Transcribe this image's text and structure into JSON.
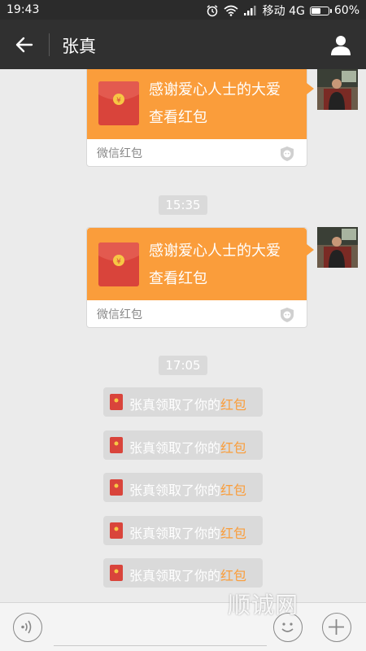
{
  "status_bar": {
    "time": "19:43",
    "carrier": "移动 4G",
    "battery_text": "60%",
    "battery_level": 0.6,
    "icons": [
      "alarm-icon",
      "wifi-icon",
      "signal-icon",
      "battery-icon"
    ]
  },
  "header": {
    "title": "张真",
    "back_icon": "back-arrow-icon",
    "profile_icon": "person-icon"
  },
  "messages": [
    {
      "type": "red_packet",
      "title": "感谢爱心人士的大爱",
      "subtitle": "查看红包",
      "footer": "微信红包"
    },
    {
      "type": "timestamp",
      "text": "15:35"
    },
    {
      "type": "red_packet",
      "title": "感谢爱心人士的大爱",
      "subtitle": "查看红包",
      "footer": "微信红包"
    },
    {
      "type": "timestamp",
      "text": "17:05"
    }
  ],
  "notices": [
    {
      "prefix": "张真领取了你的",
      "link": "红包"
    },
    {
      "prefix": "张真领取了你的",
      "link": "红包"
    },
    {
      "prefix": "张真领取了你的",
      "link": "红包"
    },
    {
      "prefix": "张真领取了你的",
      "link": "红包"
    },
    {
      "prefix": "张真领取了你的",
      "link": "红包"
    }
  ],
  "input_bar": {
    "placeholder": "",
    "icons": [
      "voice-icon",
      "emoji-icon",
      "plus-icon"
    ]
  },
  "watermark": "顺诚网",
  "colors": {
    "accent_orange": "#fa9d3b",
    "envelope_red": "#d9443b",
    "titlebar": "#303030",
    "background": "#ebebeb"
  }
}
